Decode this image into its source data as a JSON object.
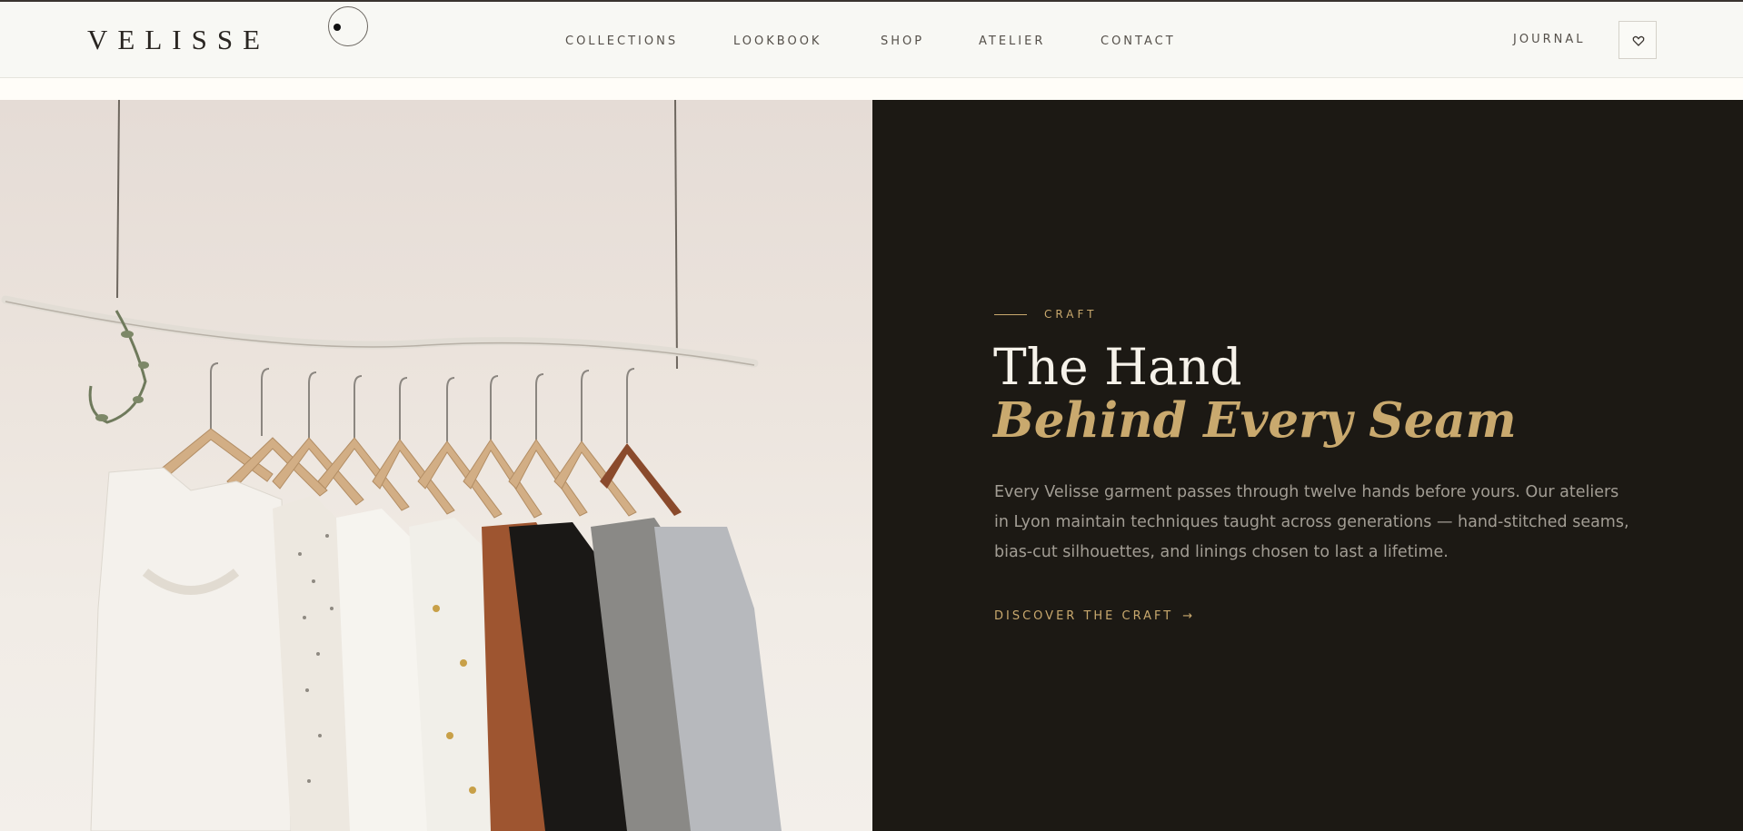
{
  "brand": {
    "logo": "VELISSE"
  },
  "nav": {
    "items": [
      "COLLECTIONS",
      "LOOKBOOK",
      "SHOP",
      "ATELIER",
      "CONTACT"
    ],
    "journal": "JOURNAL",
    "wishlist_icon": "heart-icon"
  },
  "hero": {
    "eyebrow": "CRAFT",
    "heading_line1": "The Hand",
    "heading_line2": "Behind Every Seam",
    "body": "Every Velisse garment passes through twelve hands before yours. Our ateliers in Lyon maintain techniques taught across generations — hand-stitched seams, bias-cut silhouettes, and linings chosen to last a lifetime.",
    "cta_label": "DISCOVER THE CRAFT",
    "cta_arrow": "→"
  },
  "image": {
    "subject": "clothing-rack-photo"
  },
  "colors": {
    "accent": "#c9a96e",
    "dark_panel": "#1c1914",
    "header_bg": "#f8f8f4",
    "text_dark": "#2a2622"
  }
}
